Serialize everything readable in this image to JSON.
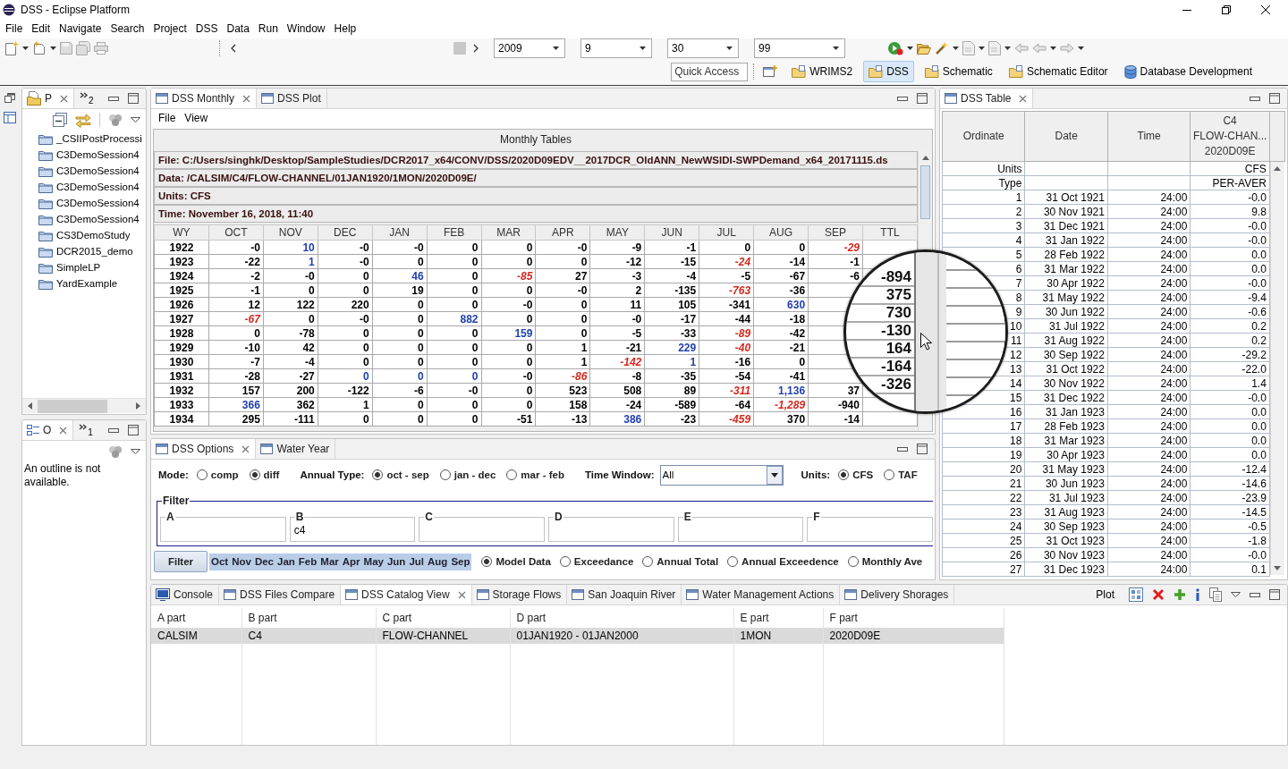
{
  "window": {
    "title": "DSS - Eclipse Platform"
  },
  "menu": [
    "File",
    "Edit",
    "Navigate",
    "Search",
    "Project",
    "DSS",
    "Data",
    "Run",
    "Window",
    "Help"
  ],
  "toolbar": {
    "combos": [
      {
        "value": "2009"
      },
      {
        "value": "9"
      },
      {
        "value": "30"
      },
      {
        "value": "99"
      }
    ]
  },
  "quick_access": {
    "placeholder": "Quick Access"
  },
  "perspectives": [
    {
      "label": "WRIMS2",
      "selected": false,
      "kind": "folder"
    },
    {
      "label": "DSS",
      "selected": true,
      "kind": "folder"
    },
    {
      "label": "Schematic",
      "selected": false,
      "kind": "folder"
    },
    {
      "label": "Schematic Editor",
      "selected": false,
      "kind": "folder"
    },
    {
      "label": "Database Development",
      "selected": false,
      "kind": "database"
    }
  ],
  "project_explorer": {
    "tab": {
      "label": "P",
      "selected": true
    },
    "overflow_count": "2",
    "items": [
      "_CSIIPostProcessi",
      "C3DemoSession4",
      "C3DemoSession4",
      "C3DemoSession4",
      "C3DemoSession4",
      "C3DemoSession4",
      "CS3DemoStudy",
      "DCR2015_demo",
      "SimpleLP",
      "YardExample"
    ]
  },
  "outline": {
    "tab": {
      "label": "O",
      "selected": true
    },
    "overflow_count": "1",
    "message": "An outline is not available."
  },
  "monthly": {
    "tabs": [
      {
        "label": "DSS Monthly",
        "selected": true
      },
      {
        "label": "DSS Plot",
        "selected": false
      }
    ],
    "menu": [
      "File",
      "View"
    ],
    "title": "Monthly Tables",
    "info": [
      "File: C:/Users/singhk/Desktop/SampleStudies/DCR2017_x64/CONV/DSS/2020D09EDV__2017DCR_OldANN_NewWSIDI-SWPDemand_x64_20171115.ds",
      "Data: /CALSIM/C4/FLOW-CHANNEL/01JAN1920/1MON/2020D09E/",
      "Units: CFS",
      "Time: November 16, 2018, 11:40"
    ],
    "columns": [
      "WY",
      "OCT",
      "NOV",
      "DEC",
      "JAN",
      "FEB",
      "MAR",
      "APR",
      "MAY",
      "JUN",
      "JUL",
      "AUG",
      "SEP",
      "TTL"
    ],
    "rows": [
      [
        "1922",
        "-0",
        {
          "text": "10",
          "color": "#1f3fae",
          "emphasis": false
        },
        "-0",
        "-0",
        "0",
        "0",
        "-0",
        "-9",
        "-1",
        "0",
        "0",
        {
          "text": "-29",
          "color": "#d42a1e",
          "emphasis": true
        },
        null
      ],
      [
        "1923",
        "-22",
        {
          "text": "1",
          "color": "#1f3fae",
          "emphasis": false
        },
        "-0",
        "0",
        "0",
        "0",
        "0",
        "-12",
        "-15",
        {
          "text": "-24",
          "color": "#d42a1e",
          "emphasis": true
        },
        "-14",
        "-1",
        null
      ],
      [
        "1924",
        "-2",
        "-0",
        "0",
        {
          "text": "46",
          "color": "#1f3fae",
          "emphasis": false
        },
        "0",
        {
          "text": "-85",
          "color": "#d42a1e",
          "emphasis": true
        },
        "27",
        "-3",
        "-4",
        "-5",
        "-67",
        "-6",
        null
      ],
      [
        "1925",
        "-1",
        "0",
        "0",
        "19",
        "0",
        "0",
        "-0",
        "2",
        "-135",
        {
          "text": "-763",
          "color": "#d42a1e",
          "emphasis": true
        },
        "-36",
        null,
        null
      ],
      [
        "1926",
        "12",
        "122",
        "220",
        "0",
        "0",
        "-0",
        "0",
        "11",
        "105",
        "-341",
        {
          "text": "630",
          "color": "#1f3fae",
          "emphasis": false
        },
        null,
        null
      ],
      [
        "1927",
        {
          "text": "-67",
          "color": "#d42a1e",
          "emphasis": true
        },
        "0",
        "-0",
        "0",
        {
          "text": "882",
          "color": "#1f3fae",
          "emphasis": false
        },
        "0",
        "0",
        "-0",
        "-17",
        "-44",
        "-18",
        null,
        null
      ],
      [
        "1928",
        "0",
        "-78",
        "0",
        "0",
        "0",
        {
          "text": "159",
          "color": "#1f3fae",
          "emphasis": false
        },
        "0",
        "-5",
        "-33",
        {
          "text": "-89",
          "color": "#d42a1e",
          "emphasis": true
        },
        "-42",
        null,
        null
      ],
      [
        "1929",
        "-10",
        "42",
        "0",
        "0",
        "0",
        "0",
        "1",
        "-21",
        {
          "text": "229",
          "color": "#1f3fae",
          "emphasis": false
        },
        {
          "text": "-40",
          "color": "#d42a1e",
          "emphasis": true
        },
        "-21",
        null,
        null
      ],
      [
        "1930",
        "-7",
        "-4",
        "0",
        "0",
        "0",
        "0",
        "1",
        {
          "text": "-142",
          "color": "#d42a1e",
          "emphasis": true
        },
        {
          "text": "1",
          "color": "#1f3fae",
          "emphasis": false
        },
        "-16",
        "0",
        null,
        null
      ],
      [
        "1931",
        "-28",
        "-27",
        {
          "text": "0",
          "color": "#1f3fae",
          "emphasis": false
        },
        {
          "text": "0",
          "color": "#1f3fae",
          "emphasis": false
        },
        {
          "text": "0",
          "color": "#1f3fae",
          "emphasis": false
        },
        "-0",
        {
          "text": "-86",
          "color": "#d42a1e",
          "emphasis": true
        },
        "-8",
        "-35",
        "-54",
        "-41",
        null,
        null
      ],
      [
        "1932",
        "157",
        "200",
        "-122",
        "-6",
        "-0",
        "0",
        "523",
        "508",
        "89",
        {
          "text": "-311",
          "color": "#d42a1e",
          "emphasis": true
        },
        {
          "text": "1,136",
          "color": "#1f3fae",
          "emphasis": false
        },
        "37",
        null
      ],
      [
        "1933",
        {
          "text": "366",
          "color": "#1f3fae",
          "emphasis": false
        },
        "362",
        "1",
        "0",
        "0",
        "0",
        "158",
        "-24",
        "-589",
        "-64",
        {
          "text": "-1,289",
          "color": "#d42a1e",
          "emphasis": true
        },
        "-940",
        null
      ],
      [
        "1934",
        "295",
        "-111",
        "0",
        "0",
        "0",
        "-51",
        "-13",
        {
          "text": "386",
          "color": "#1f3fae",
          "emphasis": false
        },
        "-23",
        {
          "text": "-459",
          "color": "#d42a1e",
          "emphasis": true
        },
        "370",
        "-14",
        null
      ]
    ]
  },
  "magnifier": {
    "values": [
      "-894",
      "375",
      "730",
      "-130",
      "164",
      "-164",
      "-326"
    ]
  },
  "options": {
    "tabs": [
      {
        "label": "DSS Options",
        "selected": true
      },
      {
        "label": "Water Year",
        "selected": false
      }
    ],
    "mode": {
      "label": "Mode:",
      "choices": [
        {
          "label": "comp",
          "selected": false
        },
        {
          "label": "diff",
          "selected": true
        }
      ]
    },
    "annual_type": {
      "label": "Annual Type:",
      "choices": [
        {
          "label": "oct - sep",
          "selected": true
        },
        {
          "label": "jan - dec",
          "selected": false
        },
        {
          "label": "mar - feb",
          "selected": false
        }
      ]
    },
    "time_window": {
      "label": "Time Window:",
      "value": "All"
    },
    "units": {
      "label": "Units:",
      "choices": [
        {
          "label": "CFS",
          "selected": true
        },
        {
          "label": "TAF",
          "selected": false
        }
      ]
    },
    "filter": {
      "title": "Filter",
      "parts": [
        {
          "label": "A"
        },
        {
          "label": "B",
          "value": "c4"
        },
        {
          "label": "C"
        },
        {
          "label": "D"
        },
        {
          "label": "E"
        },
        {
          "label": "F"
        }
      ]
    },
    "filter_button": "Filter",
    "months": [
      {
        "label": "Oct",
        "selected": true
      },
      {
        "label": "Nov",
        "selected": true
      },
      {
        "label": "Dec",
        "selected": true
      },
      {
        "label": "Jan",
        "selected": true
      },
      {
        "label": "Feb",
        "selected": true
      },
      {
        "label": "Mar",
        "selected": true
      },
      {
        "label": "Apr",
        "selected": true
      },
      {
        "label": "May",
        "selected": true
      },
      {
        "label": "Jun",
        "selected": true
      },
      {
        "label": "Jul",
        "selected": true
      },
      {
        "label": "Aug",
        "selected": true
      },
      {
        "label": "Sep",
        "selected": true
      }
    ],
    "views": [
      {
        "label": "Model Data",
        "selected": true
      },
      {
        "label": "Exceedance",
        "selected": false
      },
      {
        "label": "Annual Total",
        "selected": false
      },
      {
        "label": "Annual Exceedence",
        "selected": false
      },
      {
        "label": "Monthly Ave",
        "selected": false
      }
    ]
  },
  "dss_table": {
    "tabs": [
      {
        "label": "DSS Table",
        "selected": true
      }
    ],
    "columns": [
      "Ordinate",
      "Date",
      "Time",
      [
        "C4",
        "FLOW-CHAN...",
        "2020D09E"
      ]
    ],
    "meta": [
      {
        "label": "Units",
        "value": "CFS"
      },
      {
        "label": "Type",
        "value": "PER-AVER"
      }
    ],
    "rows": [
      [
        "1",
        "31 Oct 1921",
        "24:00",
        "-0.0"
      ],
      [
        "2",
        "30 Nov 1921",
        "24:00",
        "9.8"
      ],
      [
        "3",
        "31 Dec 1921",
        "24:00",
        "-0.0"
      ],
      [
        "4",
        "31 Jan 1922",
        "24:00",
        "-0.0"
      ],
      [
        "5",
        "28 Feb 1922",
        "24:00",
        "0.0"
      ],
      [
        "6",
        "31 Mar 1922",
        "24:00",
        "0.0"
      ],
      [
        "7",
        "30 Apr 1922",
        "24:00",
        "-0.0"
      ],
      [
        "8",
        "31 May 1922",
        "24:00",
        "-9.4"
      ],
      [
        "9",
        "30 Jun 1922",
        "24:00",
        "-0.6"
      ],
      [
        "10",
        "31 Jul 1922",
        "24:00",
        "0.2"
      ],
      [
        "11",
        "31 Aug 1922",
        "24:00",
        "0.2"
      ],
      [
        "12",
        "30 Sep 1922",
        "24:00",
        "-29.2"
      ],
      [
        "13",
        "31 Oct 1922",
        "24:00",
        "-22.0"
      ],
      [
        "14",
        "30 Nov 1922",
        "24:00",
        "1.4"
      ],
      [
        "15",
        "31 Dec 1922",
        "24:00",
        "-0.0"
      ],
      [
        "16",
        "31 Jan 1923",
        "24:00",
        "0.0"
      ],
      [
        "17",
        "28 Feb 1923",
        "24:00",
        "0.0"
      ],
      [
        "18",
        "31 Mar 1923",
        "24:00",
        "0.0"
      ],
      [
        "19",
        "30 Apr 1923",
        "24:00",
        "0.0"
      ],
      [
        "20",
        "31 May 1923",
        "24:00",
        "-12.4"
      ],
      [
        "21",
        "30 Jun 1923",
        "24:00",
        "-14.6"
      ],
      [
        "22",
        "31 Jul 1923",
        "24:00",
        "-23.9"
      ],
      [
        "23",
        "31 Aug 1923",
        "24:00",
        "-14.5"
      ],
      [
        "24",
        "30 Sep 1923",
        "24:00",
        "-0.5"
      ],
      [
        "25",
        "31 Oct 1923",
        "24:00",
        "-1.8"
      ],
      [
        "26",
        "30 Nov 1923",
        "24:00",
        "-0.0"
      ],
      [
        "27",
        "31 Dec 1923",
        "24:00",
        "0.1"
      ]
    ]
  },
  "bottom": {
    "tabs": [
      {
        "label": "Console",
        "selected": false,
        "kind": "console"
      },
      {
        "label": "DSS Files Compare",
        "selected": false,
        "kind": "view"
      },
      {
        "label": "DSS Catalog View",
        "selected": true,
        "kind": "view"
      },
      {
        "label": "Storage Flows",
        "selected": false,
        "kind": "view"
      },
      {
        "label": "San Joaquin River",
        "selected": false,
        "kind": "view"
      },
      {
        "label": "Water Management Actions",
        "selected": false,
        "kind": "view"
      },
      {
        "label": "Delivery Shorages",
        "selected": false,
        "kind": "view"
      }
    ],
    "plot_label": "Plot",
    "catalog": {
      "columns": [
        "A part",
        "B part",
        "C part",
        "D part",
        "E part",
        "F part"
      ],
      "rows": [
        {
          "cells": [
            "CALSIM",
            "C4",
            "FLOW-CHANNEL",
            "01JAN1920 - 01JAN2000",
            "1MON",
            "2020D09E"
          ],
          "selected": true
        }
      ]
    }
  }
}
